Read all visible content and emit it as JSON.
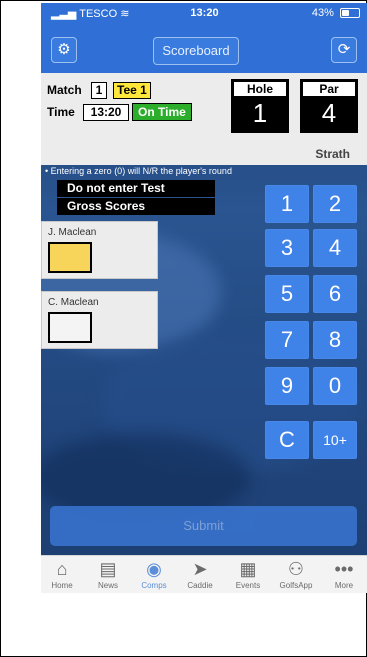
{
  "status_bar": {
    "carrier": "TESCO",
    "time": "13:20",
    "battery": "43%",
    "battery_level": 0.43
  },
  "nav": {
    "title_button": "Scoreboard",
    "settings_icon": "gear-icon",
    "refresh_icon": "refresh-icon"
  },
  "match_info": {
    "match_label": "Match",
    "match_value": "1",
    "tee_label": "Tee",
    "tee_value": "1",
    "time_label": "Time",
    "time_value": "13:20",
    "status": "On Time"
  },
  "hole": {
    "label": "Hole",
    "value": "1"
  },
  "par": {
    "label": "Par",
    "value": "4"
  },
  "course": "Strath",
  "note": "• Entering a zero (0) will N/R the player's round",
  "warnings": [
    "Do not enter Test",
    "Gross Scores"
  ],
  "players": [
    {
      "name": "J. Maclean",
      "score": "",
      "box_color": "#f7d55a"
    },
    {
      "name": "C. Maclean",
      "score": "",
      "box_color": "#f4f4f4"
    }
  ],
  "keypad": [
    "1",
    "2",
    "3",
    "4",
    "5",
    "6",
    "7",
    "8",
    "9",
    "0",
    "C",
    "10+"
  ],
  "submit_label": "Submit",
  "tabs": [
    {
      "label": "Home",
      "icon": "home-icon",
      "active": false
    },
    {
      "label": "News",
      "icon": "news-icon",
      "active": false
    },
    {
      "label": "Comps",
      "icon": "medal-icon",
      "active": true
    },
    {
      "label": "Caddie",
      "icon": "location-arrow-icon",
      "active": false
    },
    {
      "label": "Events",
      "icon": "calendar-icon",
      "active": false
    },
    {
      "label": "GolfsApp",
      "icon": "people-icon",
      "active": false
    },
    {
      "label": "More",
      "icon": "more-icon",
      "active": false
    }
  ],
  "colors": {
    "primary": "#2f6fd6",
    "keypad": "#3f82e8",
    "tee_highlight": "#ffe63b",
    "on_time": "#2cae2c"
  }
}
